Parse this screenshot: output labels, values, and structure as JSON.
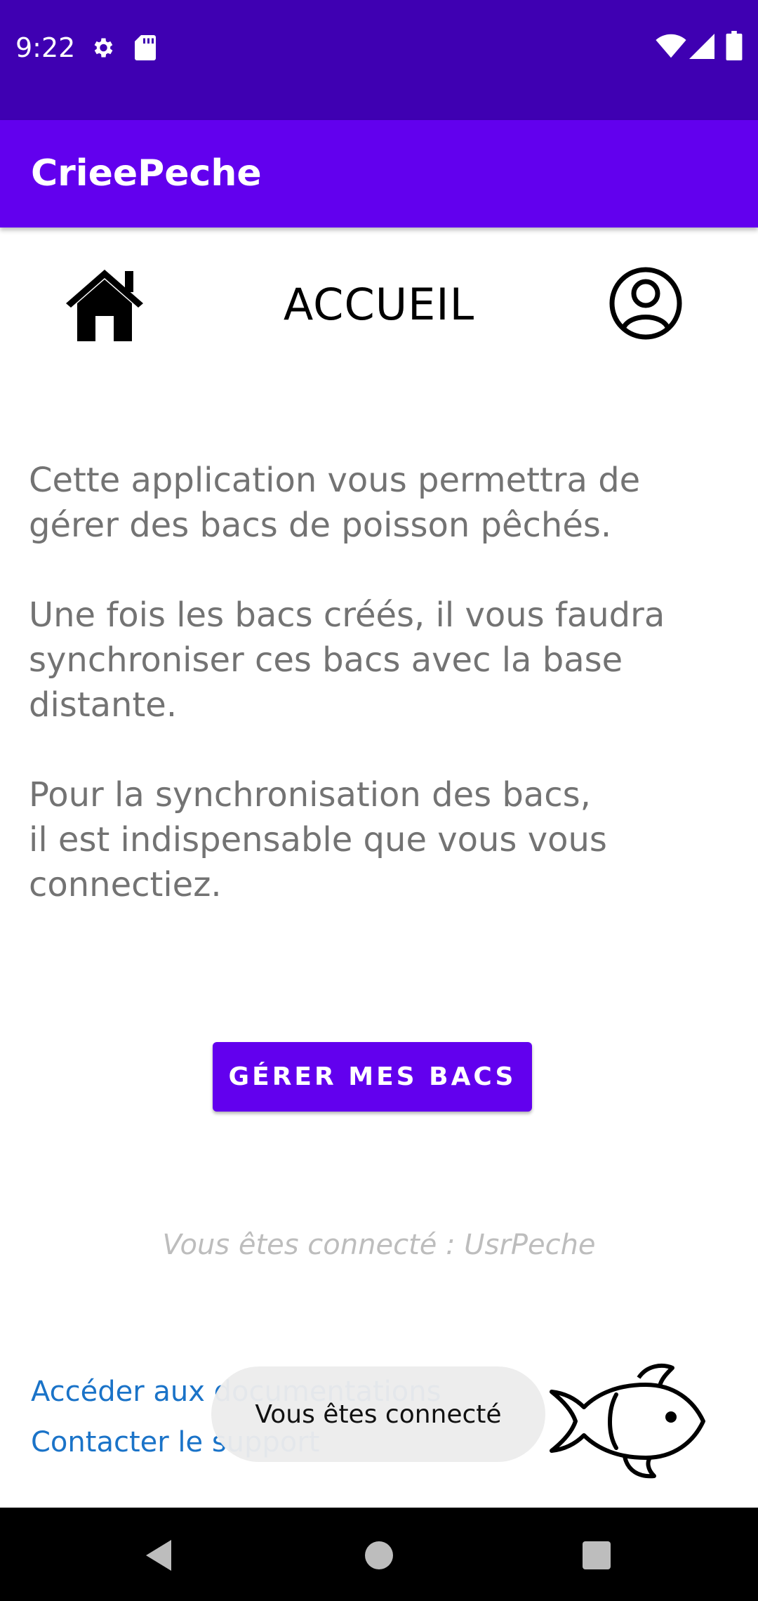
{
  "status_bar": {
    "time": "9:22",
    "left_icons": [
      "gear-icon",
      "sd-card-icon"
    ],
    "right_icons": [
      "wifi-icon",
      "signal-icon",
      "battery-icon"
    ],
    "background": "#3F00B2"
  },
  "app_bar": {
    "title": "CrieePeche",
    "background": "#6200EE"
  },
  "header": {
    "title": "ACCUEIL",
    "left_icon": "home-icon",
    "right_icon": "account-circle-icon"
  },
  "intro": {
    "paragraph_1": "Cette application vous permettra de\ngérer des bacs de poisson pêchés.",
    "paragraph_2": "Une fois les bacs créés, il vous faudra\nsynchroniser ces bacs avec la base\ndistante.",
    "paragraph_3": "Pour la synchronisation des bacs,\nil est indispensable que vous vous\nconnectiez."
  },
  "actions": {
    "manage_button_label": "GÉRER MES BACS",
    "accent": "#6200EE"
  },
  "status": {
    "connected_text": "Vous êtes connecté : UsrPeche"
  },
  "footer": {
    "docs_link": "Accéder aux documentations",
    "support_link": "Contacter le support",
    "link_color": "#1A73C8",
    "logo_icon": "fish-icon"
  },
  "toast": {
    "message": "Vous êtes connecté"
  },
  "nav_bar": {
    "icons": [
      "back-icon",
      "home-circle-icon",
      "recents-icon"
    ]
  }
}
